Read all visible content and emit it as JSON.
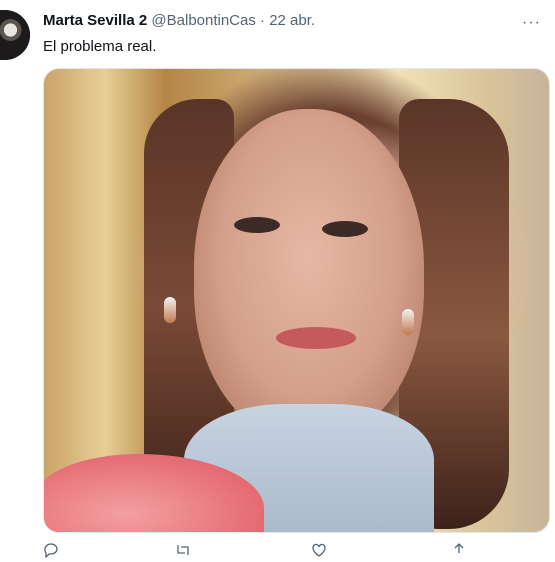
{
  "tweet": {
    "author_name": "Marta Sevilla 2",
    "handle": "@BalbontinCas",
    "separator": "·",
    "date": "22 abr.",
    "more": "···",
    "text": "El problema real."
  },
  "actions": {
    "reply_count": "",
    "retweet_count": "",
    "like_count": ""
  },
  "colors": {
    "primary_text": "#0f1419",
    "secondary_text": "#536471",
    "border": "#e1e8ed"
  },
  "icons": [
    "reply-icon",
    "retweet-icon",
    "like-icon",
    "share-icon",
    "more-icon"
  ]
}
